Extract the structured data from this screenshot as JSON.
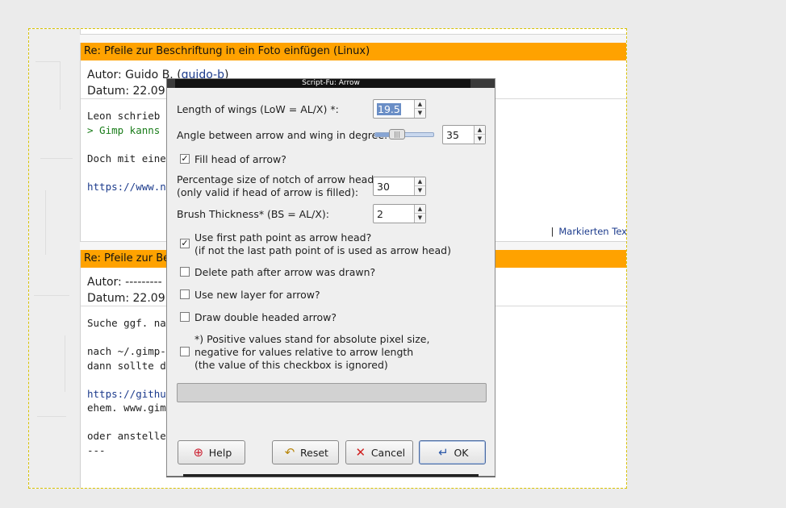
{
  "page": {
    "post1": {
      "title": "Re: Pfeile zur Beschriftung in ein Foto einfügen (Linux)",
      "author_prefix": "Autor: Guido B. (",
      "author_link": "guido-b",
      "author_suffix": ")",
      "date": "Datum: 22.09",
      "lines": [
        "Leon schrieb",
        "> Gimp kanns",
        "",
        "Doch mit eine",
        "",
        "https://www.n"
      ],
      "footer_sep": "|",
      "footer_link": "Markierten Tex"
    },
    "post2": {
      "title": "Re: Pfeile zur Bes",
      "author": "Autor: ---------",
      "date": "Datum: 22.09",
      "lines": [
        "Suche ggf. na",
        "",
        "nach ~/.gimp-",
        "dann sollte d",
        "",
        "https://githu",
        "ehem. www.gim",
        "",
        "oder anstelle",
        "---"
      ]
    }
  },
  "dialog": {
    "title": "Script-Fu: Arrow",
    "wings_label": "Length of wings (LoW = AL/X) *:",
    "wings_value": "19.5",
    "angle_label": "Angle between arrow and wing in degree:",
    "angle_value": "35",
    "angle_level": 0.35,
    "fill_label": "Fill head of arrow?",
    "fill_checked": true,
    "notch_label_1": "Percentage size of notch of arrow head",
    "notch_label_2": "(only valid if head of arrow is filled):",
    "notch_value": "30",
    "brush_label": "Brush Thickness* (BS = AL/X):",
    "brush_value": "2",
    "firstpoint_label_1": "Use first path point as arrow head?",
    "firstpoint_label_2": "(if not the last path point of is used as arrow head)",
    "firstpoint_checked": true,
    "delete_label": "Delete path after arrow was drawn?",
    "newlayer_label": "Use new layer for arrow?",
    "double_label": "Draw double headed arrow?",
    "note_1": "*) Positive values stand for absolute pixel size,",
    "note_2": "negative for values relative to arrow length",
    "note_3": "(the value of this checkbox is ignored)",
    "check_mark": "✓",
    "buttons": {
      "help": "Help",
      "reset": "Reset",
      "cancel": "Cancel",
      "ok": "OK"
    },
    "icons": {
      "help": "lifebuoy-icon",
      "reset": "reset-icon",
      "cancel": "cancel-x-icon",
      "ok": "ok-arrow-icon"
    }
  }
}
